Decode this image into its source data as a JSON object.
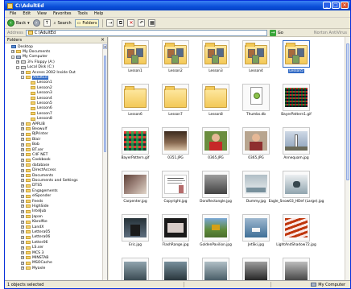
{
  "window": {
    "title": "C:\\AdultEd"
  },
  "menu": [
    "File",
    "Edit",
    "View",
    "Favorites",
    "Tools",
    "Help"
  ],
  "toolbar": {
    "back_label": "Back",
    "search_label": "Search",
    "folders_label": "Folders"
  },
  "address": {
    "label": "Address",
    "value": "C:\\AdultEd",
    "go_label": "Go",
    "links_label": "Norton AntiVirus"
  },
  "folders_pane": {
    "title": "Folders"
  },
  "tree": [
    {
      "label": "Desktop",
      "icon": "desktop-icon",
      "indent": 0,
      "exp": ""
    },
    {
      "label": "My Documents",
      "icon": "folder-icon",
      "indent": 1,
      "exp": "+"
    },
    {
      "label": "My Computer",
      "icon": "computer-icon",
      "indent": 1,
      "exp": "-"
    },
    {
      "label": "3½ Floppy (A:)",
      "icon": "drive-icon",
      "indent": 2,
      "exp": "+"
    },
    {
      "label": "Local Disk (C:)",
      "icon": "drive-icon",
      "indent": 2,
      "exp": "-"
    },
    {
      "label": "Access 2002 Inside Out",
      "icon": "folder-icon",
      "indent": 3,
      "exp": "+"
    },
    {
      "label": "AdultEd",
      "icon": "folder-icon",
      "indent": 3,
      "exp": "-",
      "selected": true
    },
    {
      "label": "Lesson1",
      "icon": "folder-icon",
      "indent": 4,
      "exp": ""
    },
    {
      "label": "Lesson2",
      "icon": "folder-icon",
      "indent": 4,
      "exp": ""
    },
    {
      "label": "Lesson3",
      "icon": "folder-icon",
      "indent": 4,
      "exp": ""
    },
    {
      "label": "Lesson4",
      "icon": "folder-icon",
      "indent": 4,
      "exp": ""
    },
    {
      "label": "Lesson5",
      "icon": "folder-icon",
      "indent": 4,
      "exp": ""
    },
    {
      "label": "Lesson6",
      "icon": "folder-icon",
      "indent": 4,
      "exp": ""
    },
    {
      "label": "Lesson7",
      "icon": "folder-icon",
      "indent": 4,
      "exp": ""
    },
    {
      "label": "Lesson8",
      "icon": "folder-icon",
      "indent": 4,
      "exp": ""
    },
    {
      "label": "APPLIB",
      "icon": "folder-icon",
      "indent": 3,
      "exp": "+"
    },
    {
      "label": "Beowulf",
      "icon": "folder-icon",
      "indent": 3,
      "exp": "+"
    },
    {
      "label": "BJPrinter",
      "icon": "folder-icon",
      "indent": 3,
      "exp": "+"
    },
    {
      "label": "Blair",
      "icon": "folder-icon",
      "indent": 3,
      "exp": "+"
    },
    {
      "label": "Bob",
      "icon": "folder-icon",
      "indent": 3,
      "exp": "+"
    },
    {
      "label": "BT.ser",
      "icon": "folder-icon",
      "indent": 3,
      "exp": "+"
    },
    {
      "label": "C4F NET",
      "icon": "folder-icon",
      "indent": 3,
      "exp": "+"
    },
    {
      "label": "Cookbook",
      "icon": "folder-icon",
      "indent": 3,
      "exp": "+"
    },
    {
      "label": "database",
      "icon": "folder-icon",
      "indent": 3,
      "exp": "+"
    },
    {
      "label": "DirectAccess",
      "icon": "folder-icon",
      "indent": 3,
      "exp": "+"
    },
    {
      "label": "Documents",
      "icon": "folder-icon",
      "indent": 3,
      "exp": "+"
    },
    {
      "label": "Documents and Settings",
      "icon": "folder-icon",
      "indent": 3,
      "exp": "+"
    },
    {
      "label": "DTS5",
      "icon": "folder-icon",
      "indent": 3,
      "exp": "+"
    },
    {
      "label": "Engagements",
      "icon": "folder-icon",
      "indent": 3,
      "exp": "+"
    },
    {
      "label": "elSponder",
      "icon": "folder-icon",
      "indent": 3,
      "exp": "+"
    },
    {
      "label": "Feeds",
      "icon": "folder-icon",
      "indent": 3,
      "exp": "+"
    },
    {
      "label": "HighSide",
      "icon": "folder-icon",
      "indent": 3,
      "exp": "+"
    },
    {
      "label": "IntelJub",
      "icon": "folder-icon",
      "indent": 3,
      "exp": "+"
    },
    {
      "label": "Japan",
      "icon": "folder-icon",
      "indent": 3,
      "exp": "+"
    },
    {
      "label": "Kbrolfke",
      "icon": "folder-icon",
      "indent": 3,
      "exp": "+"
    },
    {
      "label": "LandX",
      "icon": "folder-icon",
      "indent": 3,
      "exp": "+"
    },
    {
      "label": "Lettera05",
      "icon": "folder-icon",
      "indent": 3,
      "exp": "+"
    },
    {
      "label": "Lettera06",
      "icon": "folder-icon",
      "indent": 3,
      "exp": "+"
    },
    {
      "label": "Letter06",
      "icon": "folder-icon",
      "indent": 3,
      "exp": "+"
    },
    {
      "label": "LS.ser",
      "icon": "folder-icon",
      "indent": 3,
      "exp": "+"
    },
    {
      "label": "MCS 3",
      "icon": "folder-icon",
      "indent": 3,
      "exp": "+"
    },
    {
      "label": "MINSTAB",
      "icon": "folder-icon",
      "indent": 3,
      "exp": "+"
    },
    {
      "label": "MSOCache",
      "icon": "folder-icon",
      "indent": 3,
      "exp": "+"
    },
    {
      "label": "Myaxle",
      "icon": "folder-icon",
      "indent": 3,
      "exp": "+"
    }
  ],
  "files": [
    {
      "name": "Lesson1",
      "kind": "folder",
      "selected": false
    },
    {
      "name": "Lesson2",
      "kind": "folder",
      "selected": false
    },
    {
      "name": "Lesson3",
      "kind": "folder",
      "selected": false
    },
    {
      "name": "Lesson4",
      "kind": "folder",
      "selected": false
    },
    {
      "name": "Lesson5",
      "kind": "folder",
      "selected": true
    },
    {
      "name": "Lesson6",
      "kind": "folder-empty",
      "selected": false
    },
    {
      "name": "Lesson7",
      "kind": "folder-empty",
      "selected": false
    },
    {
      "name": "Lesson8",
      "kind": "folder-empty",
      "selected": false
    },
    {
      "name": "Thumbs.db",
      "kind": "file",
      "selected": false
    },
    {
      "name": "BayerPattern1.gif",
      "kind": "pattern",
      "selected": false
    },
    {
      "name": "BayerPattern.gif",
      "kind": "pattern2",
      "selected": false
    },
    {
      "name": "0351.JPG",
      "kind": "photo-cake",
      "selected": false
    },
    {
      "name": "0365.JPG",
      "kind": "photo-person1",
      "selected": false
    },
    {
      "name": "0365.JPG",
      "kind": "photo-person2",
      "selected": false
    },
    {
      "name": "Annequam.jpg",
      "kind": "photo-lighthouse",
      "selected": false
    },
    {
      "name": "Carpenter.jpg",
      "kind": "photo-carpenter",
      "selected": false
    },
    {
      "name": "Copyright.jpg",
      "kind": "photo-doc",
      "selected": false
    },
    {
      "name": "DoroRectangle.jpg",
      "kind": "photo-gray",
      "selected": false
    },
    {
      "name": "Dummy.jpg",
      "kind": "photo-dummy",
      "selected": false
    },
    {
      "name": "Eagle_Snow03_HDef (Large).jpg",
      "kind": "photo-snow",
      "selected": false
    },
    {
      "name": "Eric.jpg",
      "kind": "photo-eric",
      "selected": false
    },
    {
      "name": "FlashRange.jpg",
      "kind": "photo-flash",
      "selected": false
    },
    {
      "name": "GoldenPavilion.jpg",
      "kind": "photo-pavilion",
      "selected": false
    },
    {
      "name": "JetSki.jpg",
      "kind": "photo-jetski",
      "selected": false
    },
    {
      "name": "LightAndShadow72.jpg",
      "kind": "photo-stairs",
      "selected": false
    },
    {
      "name": "",
      "kind": "photo-row6a",
      "selected": false
    },
    {
      "name": "",
      "kind": "photo-row6b",
      "selected": false
    },
    {
      "name": "",
      "kind": "photo-row6c",
      "selected": false
    },
    {
      "name": "",
      "kind": "photo-row6d",
      "selected": false
    },
    {
      "name": "",
      "kind": "photo-row6e",
      "selected": false
    }
  ],
  "status": {
    "left": "1 objects selected",
    "right": "My Computer"
  }
}
